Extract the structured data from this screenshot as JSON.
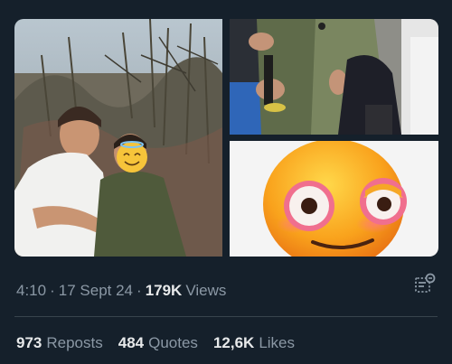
{
  "media": {
    "photo_left_alt": "Two people posing among trees",
    "photo_top_right_alt": "Close-up of hands and clothing",
    "photo_bottom_right_alt": "Flushed smiling emoji"
  },
  "tweet_meta": {
    "time": "4:10",
    "separator1": "·",
    "date": "17 Sept 24",
    "separator2": "·",
    "views_count": "179K",
    "views_label": "Views"
  },
  "stats": [
    {
      "count": "973",
      "label": "Reposts"
    },
    {
      "count": "484",
      "label": "Quotes"
    },
    {
      "count": "12,6K",
      "label": "Likes"
    }
  ],
  "colors": {
    "background": "#15202b",
    "text_primary": "#e7e9ea",
    "text_secondary": "#8b98a5",
    "divider": "#38444d"
  }
}
